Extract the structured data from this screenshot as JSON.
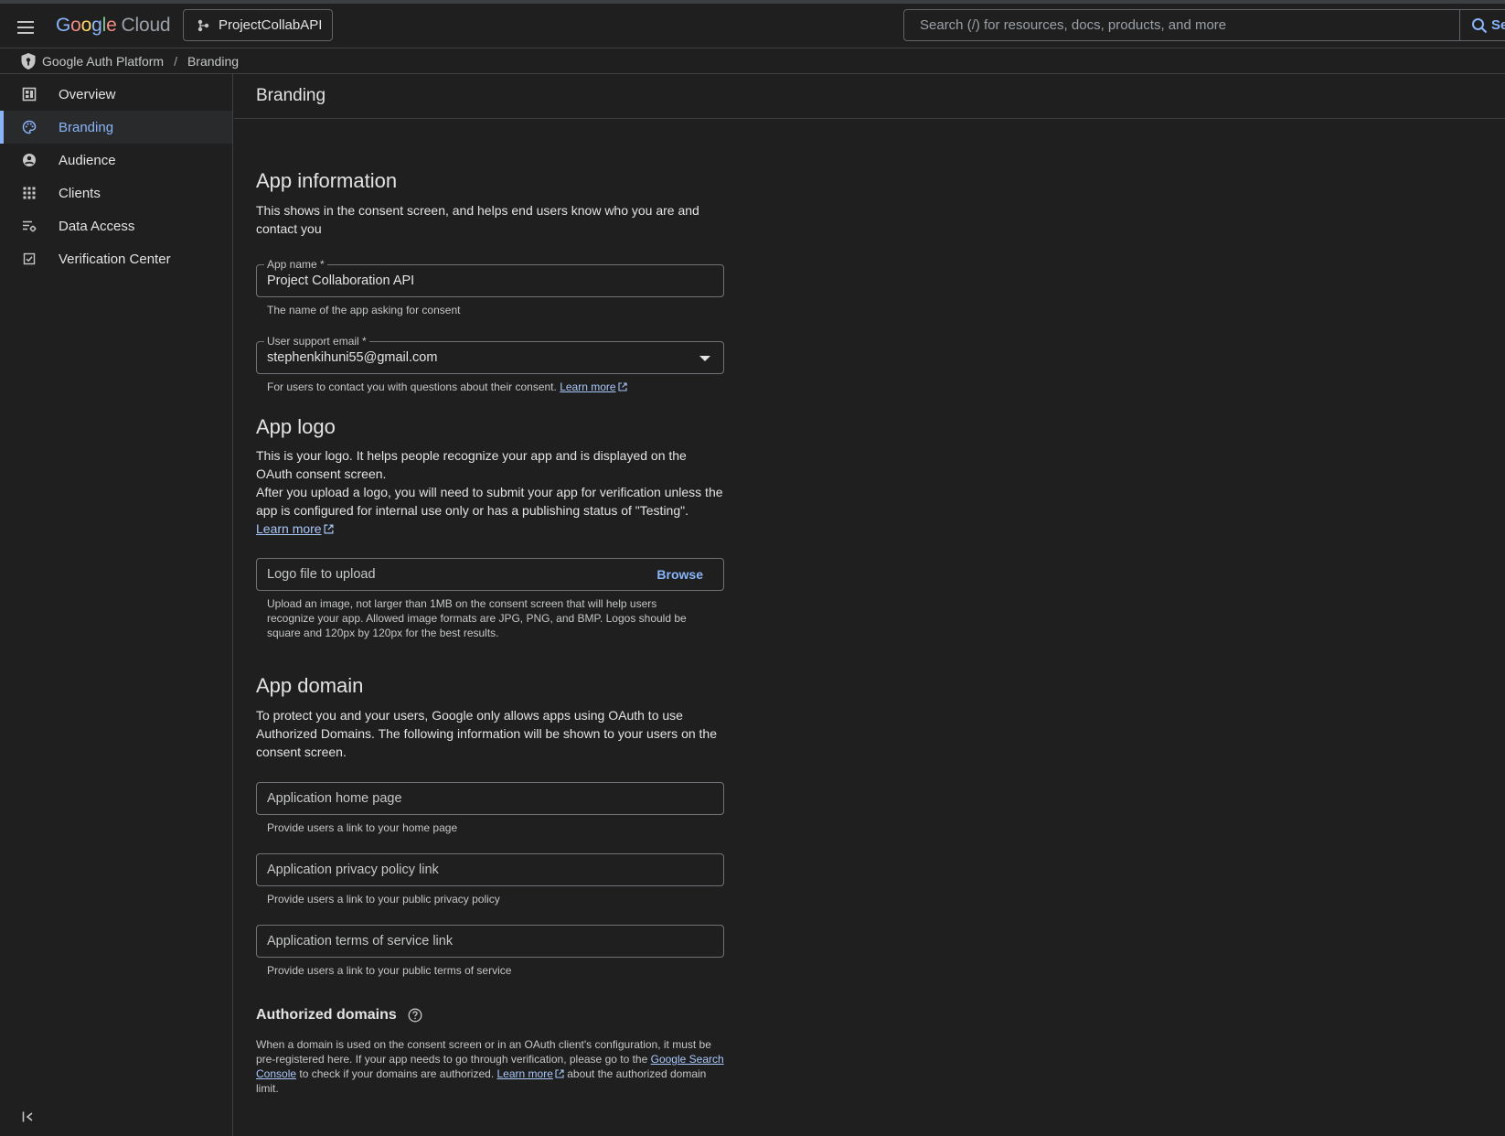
{
  "header": {
    "logo_word_parts": [
      "G",
      "o",
      "o",
      "g",
      "l",
      "e"
    ],
    "logo_product": "Cloud",
    "project_name": "ProjectCollabAPI",
    "search_placeholder": "Search (/) for resources, docs, products, and more",
    "search_button_label": "Se"
  },
  "breadcrumb": {
    "items": [
      "Google Auth Platform",
      "Branding"
    ],
    "separator": "/"
  },
  "sidebar": {
    "items": [
      {
        "label": "Overview",
        "icon": "dashboard-icon"
      },
      {
        "label": "Branding",
        "icon": "palette-icon",
        "active": true
      },
      {
        "label": "Audience",
        "icon": "account-circle-icon"
      },
      {
        "label": "Clients",
        "icon": "grid-icon"
      },
      {
        "label": "Data Access",
        "icon": "data-settings-icon"
      },
      {
        "label": "Verification Center",
        "icon": "verified-checkbox-icon"
      }
    ],
    "collapse_icon": "collapse-sidebar-icon"
  },
  "page": {
    "title": "Branding"
  },
  "app_information": {
    "heading": "App information",
    "description": "This shows in the consent screen, and helps end users know who you are and contact you",
    "app_name": {
      "label": "App name *",
      "value": "Project Collaboration API",
      "hint": "The name of the app asking for consent"
    },
    "support_email": {
      "label": "User support email *",
      "value": "stephenkihuni55@gmail.com",
      "hint": "For users to contact you with questions about their consent.",
      "learn_more": "Learn more"
    }
  },
  "app_logo": {
    "heading": "App logo",
    "description_1": "This is your logo. It helps people recognize your app and is displayed on the OAuth consent screen.",
    "description_2": "After you upload a logo, you will need to submit your app for verification unless the app is configured for internal use only or has a publishing status of \"Testing\".",
    "learn_more": "Learn more",
    "upload_placeholder": "Logo file to upload",
    "browse_label": "Browse",
    "hint": "Upload an image, not larger than 1MB on the consent screen that will help users recognize your app. Allowed image formats are JPG, PNG, and BMP. Logos should be square and 120px by 120px for the best results."
  },
  "app_domain": {
    "heading": "App domain",
    "description": "To protect you and your users, Google only allows apps using OAuth to use Authorized Domains. The following information will be shown to your users on the consent screen.",
    "home_page": {
      "placeholder": "Application home page",
      "hint": "Provide users a link to your home page"
    },
    "privacy_policy": {
      "placeholder": "Application privacy policy link",
      "hint": "Provide users a link to your public privacy policy"
    },
    "terms_of_service": {
      "placeholder": "Application terms of service link",
      "hint": "Provide users a link to your public terms of service"
    }
  },
  "authorized_domains": {
    "heading": "Authorized domains",
    "text_1": "When a domain is used on the consent screen or in an OAuth client's configuration, it must be pre-registered here. If your app needs to go through verification, please go to the",
    "link_search_console": "Google Search Console",
    "text_2": "to check if your domains are authorized.",
    "learn_more": "Learn more",
    "text_3": "about the authorized domain limit."
  },
  "colors": {
    "background": "#1f1f1f",
    "accent": "#8ab4f8",
    "border": "#3c4043",
    "text": "#e3e3e3"
  }
}
